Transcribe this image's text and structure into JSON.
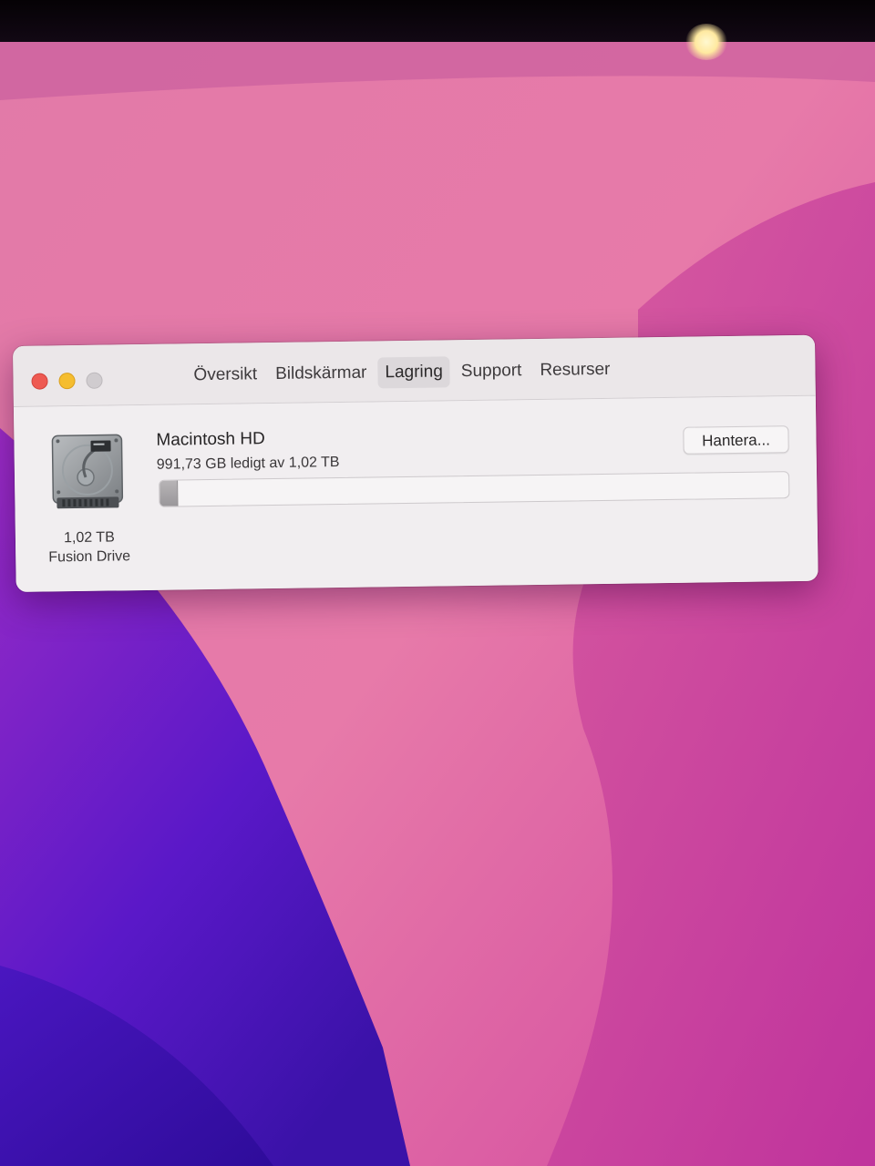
{
  "window": {
    "tabs": [
      {
        "label": "Översikt",
        "active": false
      },
      {
        "label": "Bildskärmar",
        "active": false
      },
      {
        "label": "Lagring",
        "active": true
      },
      {
        "label": "Support",
        "active": false
      },
      {
        "label": "Resurser",
        "active": false
      }
    ]
  },
  "storage": {
    "disk_icon": "hard-drive-icon",
    "disk_size": "1,02 TB",
    "disk_type": "Fusion Drive",
    "volume_name": "Macintosh HD",
    "free_text": "991,73 GB ledigt av 1,02 TB",
    "manage_button": "Hantera...",
    "used_fraction": 0.028
  },
  "colors": {
    "close": "#ee5a52",
    "minimize": "#f5bd2f",
    "zoom_disabled": "#d0cccf",
    "used_segment": "#a8a5a8"
  }
}
